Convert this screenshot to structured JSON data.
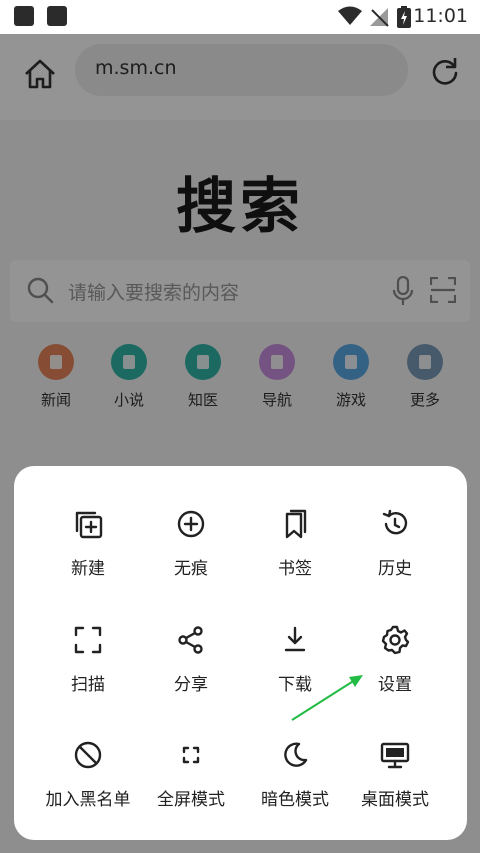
{
  "status_bar": {
    "time": "11:01"
  },
  "address_bar": {
    "url": "m.sm.cn"
  },
  "page": {
    "logo": "搜索",
    "search_placeholder": "请输入要搜索的内容",
    "quick_links": [
      {
        "label": "新闻",
        "icon": "news-icon",
        "color": "#e8865a"
      },
      {
        "label": "小说",
        "icon": "novel-icon",
        "color": "#2fb6a8"
      },
      {
        "label": "知医",
        "icon": "medical-kit-icon",
        "color": "#2fb6a8"
      },
      {
        "label": "导航",
        "icon": "navigation-icon",
        "color": "#c98ee0"
      },
      {
        "label": "游戏",
        "icon": "gamepad-icon",
        "color": "#5aa9e6"
      },
      {
        "label": "更多",
        "icon": "more-icon",
        "color": "#7a9bb8"
      }
    ]
  },
  "menu": {
    "items": [
      {
        "label": "新建",
        "icon": "new-tab-icon"
      },
      {
        "label": "无痕",
        "icon": "incognito-plus-icon"
      },
      {
        "label": "书签",
        "icon": "bookmark-icon"
      },
      {
        "label": "历史",
        "icon": "history-icon"
      },
      {
        "label": "扫描",
        "icon": "scan-icon"
      },
      {
        "label": "分享",
        "icon": "share-icon"
      },
      {
        "label": "下载",
        "icon": "download-icon"
      },
      {
        "label": "设置",
        "icon": "gear-icon"
      },
      {
        "label": "加入黑名单",
        "icon": "block-icon"
      },
      {
        "label": "全屏模式",
        "icon": "fullscreen-icon"
      },
      {
        "label": "暗色模式",
        "icon": "moon-icon"
      },
      {
        "label": "桌面模式",
        "icon": "desktop-icon"
      }
    ]
  },
  "annotation": {
    "arrow_color": "#22bb44"
  }
}
